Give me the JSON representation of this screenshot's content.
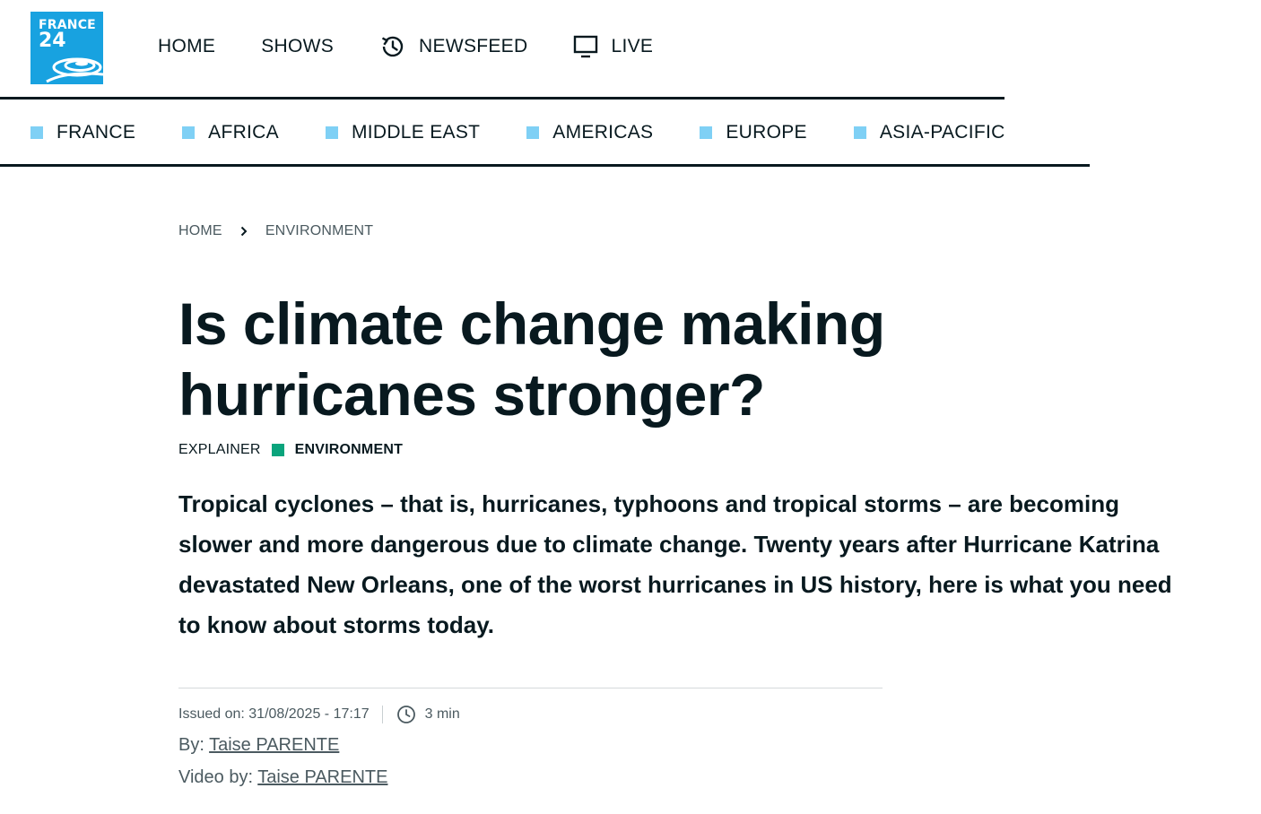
{
  "brand": {
    "line1": "FRANCE",
    "line2": "24",
    "color": "#18a2e0"
  },
  "main_nav": [
    {
      "label": "HOME",
      "icon": ""
    },
    {
      "label": "SHOWS",
      "icon": ""
    },
    {
      "label": "NEWSFEED",
      "icon": "history-icon"
    },
    {
      "label": "LIVE",
      "icon": "monitor-icon"
    }
  ],
  "regions": [
    "FRANCE",
    "AFRICA",
    "MIDDLE EAST",
    "AMERICAS",
    "EUROPE",
    "ASIA-PACIFIC"
  ],
  "region_marker_color": "#7fd0f5",
  "breadcrumb": {
    "home": "HOME",
    "section": "ENVIRONMENT"
  },
  "article": {
    "title": "Is climate change making hurricanes stronger?",
    "kind": "EXPLAINER",
    "category": "ENVIRONMENT",
    "category_color": "#0aa47c",
    "lead": "Tropical cyclones – that is, hurricanes, typhoons and tropical storms – are becoming slower and more dangerous due to climate change. Twenty years after Hurricane Katrina devastated New Orleans, one of the worst hurricanes in US history, here is what you need to know about storms today.",
    "issued": "Issued on: 31/08/2025 - 17:17",
    "read_time": "3 min",
    "by_label": "By:",
    "author": "Taise PARENTE",
    "video_by_label": "Video by:",
    "video_author": "Taise PARENTE"
  }
}
